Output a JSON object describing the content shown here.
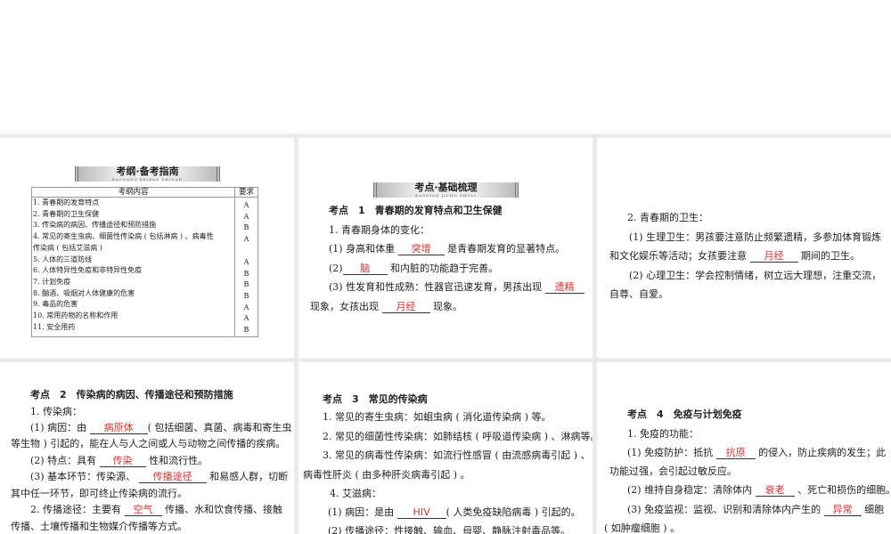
{
  "outline": {
    "banner": "考纲·备考指南",
    "banner_sub": "KAOGANG    BEIKAO ZHINAN",
    "col_content": "考纲内容",
    "col_req": "要求",
    "items": [
      "1. 青春期的发育特点",
      "2. 青春期的卫生保健",
      "3. 传染病的病因、传播途径和预防措施",
      "4. 常见的寄生虫病、细菌性传染病 ( 包括淋病 ) 、病毒性",
      "传染病 ( 包括艾滋病 )",
      "5. 人体的三道防线",
      "6. 人体特异性免疫和非特异性免疫",
      "7. 计划免疫",
      "8. 酗酒、吸烟对人体健康的危害",
      "9. 毒品的危害",
      "10. 常用药物的名称和作用",
      "11. 安全用药"
    ],
    "reqs": [
      "A",
      "A",
      "B",
      "A",
      "A",
      "B",
      "B",
      "B",
      "A",
      "A",
      "B"
    ]
  },
  "p2": {
    "banner": "考点·基础梳理",
    "banner_sub": "KAODIAN    JICHU SHULI",
    "title": "考点　1　青春期的发育特点和卫生保健",
    "l1": "1. 青春期身体的变化：",
    "l2a": "(1) 身高和体重 ",
    "b1": "突增",
    "l2b": " 是青春期发育的显著特点。",
    "l3a": "(2)",
    "b2": "脑",
    "l3b": " 和内脏的功能趋于完善。",
    "l4a": "(3) 性发育和性成熟：性器官迅速发育，男孩出现 ",
    "b3": "遗精",
    "l5a": "现象，女孩出现 ",
    "b4": "月经",
    "l5b": " 现象。"
  },
  "p3": {
    "l1": "2. 青春期的卫生：",
    "l2": "(1) 生理卫生：男孩要注意防止频繁遗精，多参加体育锻炼",
    "l3a": "和文化娱乐等活动；女孩要注意 ",
    "b1": "月经",
    "l3b": " 期间的卫生。",
    "l4": "(2) 心理卫生：学会控制情绪，树立远大理想，注重交流，",
    "l5": "自尊、自爱。"
  },
  "p4": {
    "title": "考点　2　传染病的病因、传播途径和预防措施",
    "l1": "1. 传染病：",
    "l2a": "(1) 病因：由 ",
    "b1": "病原体",
    "l2b": "( 包括细菌、真菌、病毒和寄生虫",
    "l3": "等生物 ) 引起的，能在人与人之间或人与动物之间传播的疾病。",
    "l4a": "(2) 特点：具有 ",
    "b2": "传染",
    "l4b": " 性和流行性。",
    "l5a": "(3) 基本环节：传染源、 ",
    "b3": "传播途径",
    "l5b": " 和易感人群，切断",
    "l6": "其中任一环节，即可终止传染病的流行。",
    "l7a": "2. 传播途径：主要有 ",
    "b4": "空气",
    "l7b": " 传播、水和饮食传播、接触",
    "l8": "传播、土壤传播和生物媒介传播等方式。"
  },
  "p5": {
    "title": "考点　3　常见的传染病",
    "l1": "1. 常见的寄生虫病：如蛔虫病 ( 消化道传染病 ) 等。",
    "l2": "2. 常见的细菌性传染病：如肺结核 ( 呼吸道传染病 ) 、淋病等。",
    "l3": "3. 常见的病毒性传染病：如流行性感冒 ( 由流感病毒引起 ) 、",
    "l4": "病毒性肝炎 ( 由多种肝炎病毒引起 ) 。",
    "l5": "4. 艾滋病：",
    "l6a": "(1) 病因：是由 ",
    "b1": "HIV",
    "l6b": "( 人类免疫缺陷病毒 ) 引起的。",
    "l7": "(2) 传播途径：性接触、输血、母婴、静脉注射毒品等。"
  },
  "p6": {
    "title": "考点　4　免疫与计划免疫",
    "l1": "1. 免疫的功能：",
    "l2a": "(1) 免疫防护：抵抗 ",
    "b1": "抗原",
    "l2b": " 的侵入，防止疾病的发生；此",
    "l3": "功能过强，会引起过敏反应。",
    "l4a": "(2) 维持自身稳定：清除体内 ",
    "b2": "衰老",
    "l4b": " 、死亡和损伤的细胞。",
    "l5a": "(3) 免疫监视：监视、识别和清除体内产生的 ",
    "b3": "异常",
    "l5b": " 细胞",
    "l6": "( 如肿瘤细胞 ) 。"
  }
}
